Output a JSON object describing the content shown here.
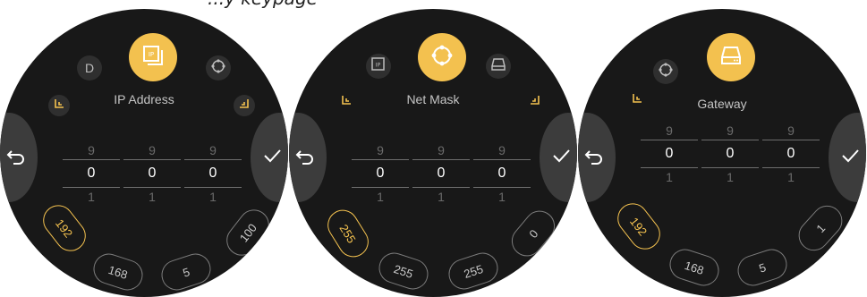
{
  "caption": "...y keypage",
  "colors": {
    "accent": "#f3c14f",
    "bg": "#181818",
    "button": "#3c3c3c"
  },
  "screens": [
    {
      "title": "IP Address",
      "top_small_left": "D",
      "columns": [
        {
          "up": "9",
          "value": "0",
          "down": "1"
        },
        {
          "up": "9",
          "value": "0",
          "down": "1"
        },
        {
          "up": "9",
          "value": "0",
          "down": "1"
        }
      ],
      "chips": [
        "192",
        "168",
        "5",
        "100"
      ],
      "selected_chip": "192",
      "icons": [
        "back-icon",
        "confirm-icon",
        "ip-icon",
        "network-icon"
      ]
    },
    {
      "title": "Net Mask",
      "columns": [
        {
          "up": "9",
          "value": "0",
          "down": "1"
        },
        {
          "up": "9",
          "value": "0",
          "down": "1"
        },
        {
          "up": "9",
          "value": "0",
          "down": "1"
        }
      ],
      "chips": [
        "255",
        "255",
        "255",
        "0"
      ],
      "selected_chip": "255",
      "icons": [
        "back-icon",
        "confirm-icon",
        "ip-icon",
        "network-icon",
        "gateway-icon"
      ]
    },
    {
      "title": "Gateway",
      "columns": [
        {
          "up": "9",
          "value": "0",
          "down": "1"
        },
        {
          "up": "9",
          "value": "0",
          "down": "1"
        },
        {
          "up": "9",
          "value": "0",
          "down": "1"
        }
      ],
      "chips": [
        "192",
        "168",
        "5",
        "1"
      ],
      "selected_chip": "192",
      "icons": [
        "back-icon",
        "confirm-icon",
        "network-icon",
        "gateway-icon"
      ]
    }
  ]
}
